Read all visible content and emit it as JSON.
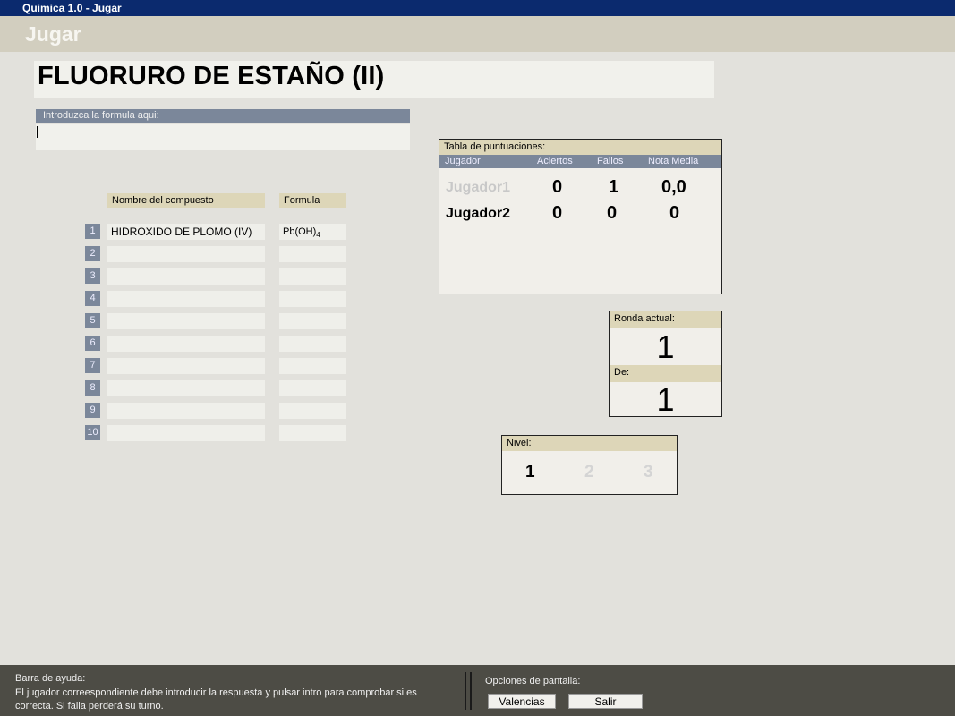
{
  "window": {
    "title": "Quimica 1.0 - Jugar"
  },
  "header": {
    "title": "Jugar"
  },
  "compound": {
    "name": "FLUORURO DE ESTAÑO (II)"
  },
  "formula_input": {
    "label": "Introduzca la formula aqui:",
    "value": ""
  },
  "table": {
    "col_name": "Nombre del compuesto",
    "col_formula": "Formula",
    "rows": [
      {
        "num": "1",
        "name": "HIDROXIDO DE PLOMO (IV)",
        "formula_base": "Pb(OH)",
        "formula_sub": "4"
      },
      {
        "num": "2",
        "name": "",
        "formula_base": "",
        "formula_sub": ""
      },
      {
        "num": "3",
        "name": "",
        "formula_base": "",
        "formula_sub": ""
      },
      {
        "num": "4",
        "name": "",
        "formula_base": "",
        "formula_sub": ""
      },
      {
        "num": "5",
        "name": "",
        "formula_base": "",
        "formula_sub": ""
      },
      {
        "num": "6",
        "name": "",
        "formula_base": "",
        "formula_sub": ""
      },
      {
        "num": "7",
        "name": "",
        "formula_base": "",
        "formula_sub": ""
      },
      {
        "num": "8",
        "name": "",
        "formula_base": "",
        "formula_sub": ""
      },
      {
        "num": "9",
        "name": "",
        "formula_base": "",
        "formula_sub": ""
      },
      {
        "num": "10",
        "name": "",
        "formula_base": "",
        "formula_sub": ""
      }
    ]
  },
  "scores": {
    "title": "Tabla de puntuaciones:",
    "headers": {
      "player": "Jugador",
      "hits": "Aciertos",
      "fails": "Fallos",
      "avg": "Nota Media"
    },
    "players": [
      {
        "name": "Jugador1",
        "hits": "0",
        "fails": "1",
        "avg": "0,0",
        "active": false
      },
      {
        "name": "Jugador2",
        "hits": "0",
        "fails": "0",
        "avg": "0",
        "active": true
      }
    ]
  },
  "round": {
    "label": "Ronda actual:",
    "current": "1",
    "of_label": "De:",
    "total": "1"
  },
  "level": {
    "label": "Nivel:",
    "options": [
      "1",
      "2",
      "3"
    ],
    "selected": "1"
  },
  "footer": {
    "help_title": "Barra de ayuda:",
    "help_text": "El jugador correespondiente debe introducir la respuesta y pulsar intro para comprobar si es correcta. Si falla perderá su turno.",
    "options_title": "Opciones de pantalla:",
    "btn_valencias": "Valencias",
    "btn_salir": "Salir"
  },
  "colors": {
    "titlebar": "#0b2a6e",
    "header": "#d2cebf",
    "label_blue": "#7b879a",
    "label_tan": "#ddd6b8",
    "footer": "#4d4c45",
    "inactive_player": "#c8c8c8"
  }
}
